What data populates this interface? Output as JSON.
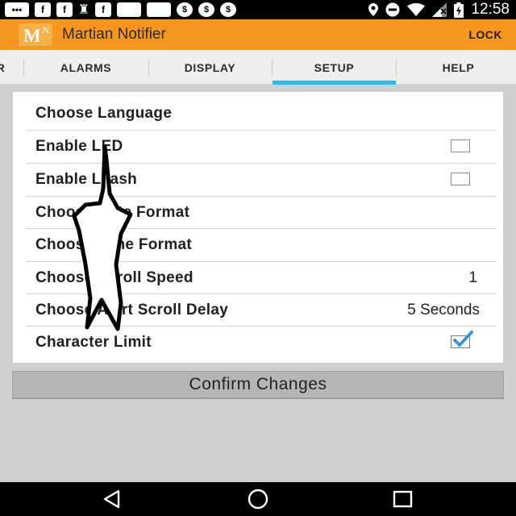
{
  "status_bar": {
    "icons": [
      "chat-icon",
      "facebook-icon",
      "facebook-icon",
      "keyhole-icon",
      "facebook-icon",
      "notification-icon",
      "notification-icon",
      "dollar-icon",
      "dollar-icon",
      "dollar-icon"
    ],
    "icon_glyphs": [
      "•••",
      "f",
      "f",
      "♜",
      "f",
      "",
      "",
      "$",
      "$",
      "$"
    ],
    "right_icons": [
      "location-icon",
      "do-not-disturb-icon",
      "wifi-icon",
      "signal-icon",
      "battery-charging-icon"
    ],
    "time": "12:58"
  },
  "app_bar": {
    "title": "Martian Notifier",
    "logo_letter": "M",
    "logo_sup": "N",
    "action": "LOCK",
    "color": "#f7961e"
  },
  "tabs": {
    "items": [
      {
        "label": "R",
        "partial": true
      },
      {
        "label": "ALARMS"
      },
      {
        "label": "DISPLAY"
      },
      {
        "label": "SETUP",
        "selected": true
      },
      {
        "label": "HELP"
      }
    ],
    "indicator_color": "#33b5e5"
  },
  "settings": {
    "rows": [
      {
        "label": "Choose Language",
        "control": "none"
      },
      {
        "label": "Enable LED",
        "control": "checkbox",
        "checked": false
      },
      {
        "label": "Enable Leash",
        "control": "checkbox",
        "checked": false
      },
      {
        "label": "Choose Date Format",
        "control": "none"
      },
      {
        "label": "Choose Time Format",
        "control": "none"
      },
      {
        "label": "Choose Scroll Speed",
        "control": "value",
        "value": "1"
      },
      {
        "label": "Choose Alert Scroll Delay",
        "control": "value",
        "value": "5 Seconds"
      },
      {
        "label": "Character Limit",
        "control": "checkbox",
        "checked": true
      }
    ]
  },
  "confirm_button": {
    "label": "Confirm Changes"
  },
  "nav_bar": {
    "buttons": [
      "back-icon",
      "home-icon",
      "recent-apps-icon"
    ]
  },
  "overlay": {
    "icon": "pointer-arrow-overlay-icon"
  }
}
